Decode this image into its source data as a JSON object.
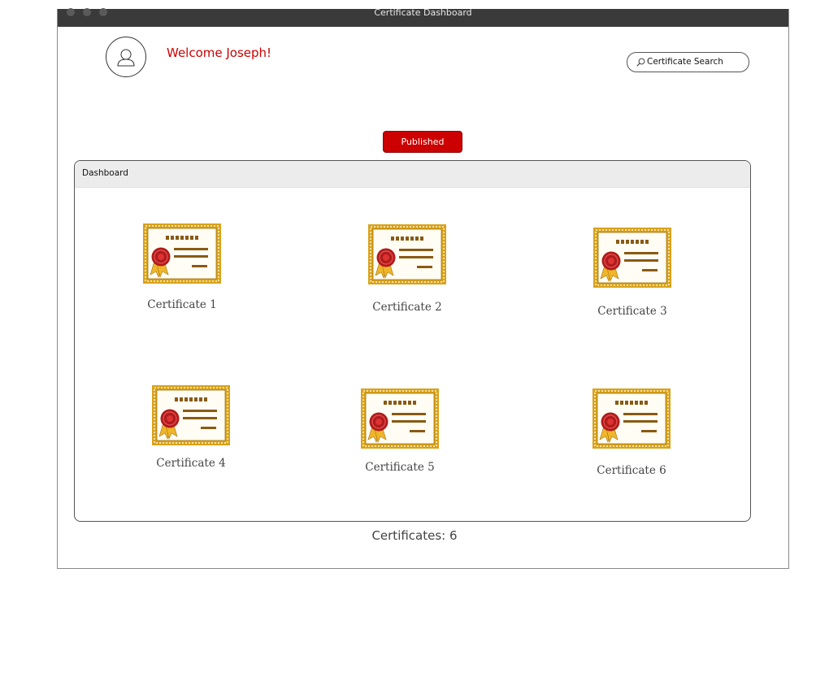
{
  "window": {
    "title": "Certificate Dashboard"
  },
  "header": {
    "welcome": "Welcome Joseph!",
    "search": {
      "placeholder": "Certificate Search",
      "value": ""
    }
  },
  "tabs": {
    "published": "Published"
  },
  "panel": {
    "title": "Dashboard"
  },
  "certificates": [
    {
      "label": "Certificate 1"
    },
    {
      "label": "Certificate 2"
    },
    {
      "label": "Certificate 3"
    },
    {
      "label": "Certificate 4"
    },
    {
      "label": "Certificate 5"
    },
    {
      "label": "Certificate 6"
    }
  ],
  "footer": {
    "count": "Certificates: 6"
  },
  "colors": {
    "accent": "#cc0000",
    "gold": "#d9a21b",
    "seal": "#b01b1b"
  }
}
